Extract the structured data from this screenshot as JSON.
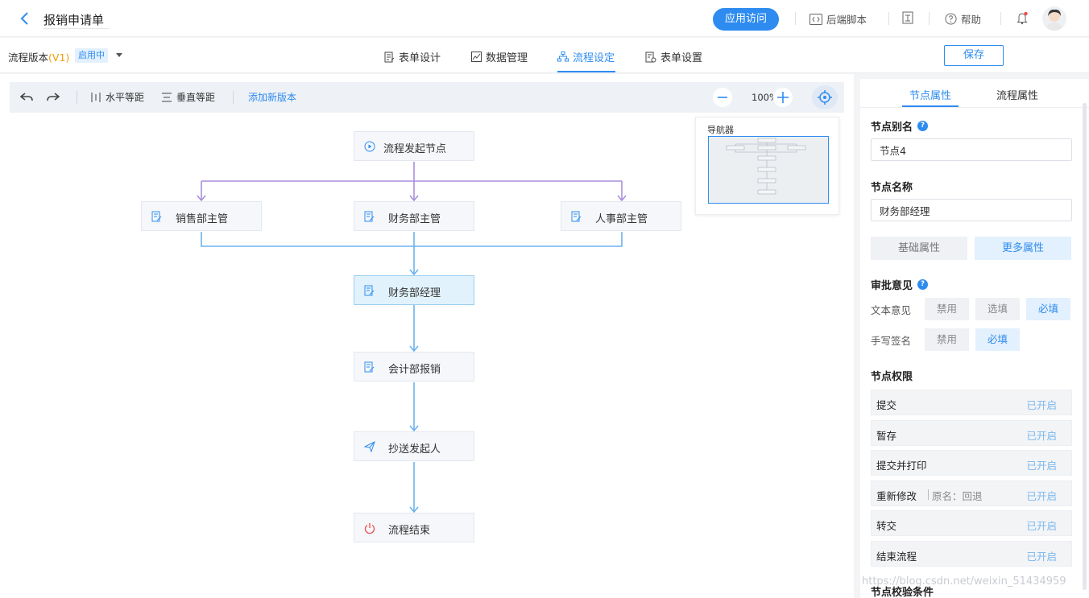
{
  "header": {
    "title": "报销申请单",
    "visit_button": "应用访问",
    "backend_script": "后端脚本",
    "help": "帮助"
  },
  "subheader": {
    "version_label": "流程版本",
    "version_number": "(V1)",
    "version_status": "启用中",
    "tabs": [
      {
        "label": "表单设计",
        "icon": "form-icon"
      },
      {
        "label": "数据管理",
        "icon": "data-icon"
      },
      {
        "label": "流程设定",
        "icon": "flow-icon",
        "active": true
      },
      {
        "label": "表单设置",
        "icon": "settings-icon"
      }
    ],
    "save_button": "保存"
  },
  "toolbar": {
    "horizontal_spacing": "水平等距",
    "vertical_spacing": "垂直等距",
    "add_version": "添加新版本",
    "zoom": "100%"
  },
  "flow": {
    "start_node": "流程发起节点",
    "branches": [
      "销售部主管",
      "财务部主管",
      "人事部主管"
    ],
    "selected_node": "财务部经理",
    "accounting_node": "会计部报销",
    "cc_node": "抄送发起人",
    "end_node": "流程结束"
  },
  "navigator": {
    "title": "导航器"
  },
  "panel": {
    "tabs": [
      "节点属性",
      "流程属性"
    ],
    "alias_title": "节点别名",
    "alias_value": "节点4",
    "name_title": "节点名称",
    "name_value": "财务部经理",
    "prop_tabs": [
      "基础属性",
      "更多属性"
    ],
    "approval_title": "审批意见",
    "text_opinion": {
      "label": "文本意见",
      "options": [
        "禁用",
        "选填",
        "必填"
      ],
      "selected": "必填"
    },
    "handwriting": {
      "label": "手写签名",
      "options": [
        "禁用",
        "必填"
      ],
      "selected": "必填"
    },
    "perm_title": "节点权限",
    "permissions": [
      {
        "name": "提交",
        "status": "已开启"
      },
      {
        "name": "暂存",
        "status": "已开启"
      },
      {
        "name": "提交并打印",
        "status": "已开启"
      },
      {
        "name": "重新修改",
        "alias": "原名：回退",
        "status": "已开启"
      },
      {
        "name": "转交",
        "status": "已开启"
      },
      {
        "name": "结束流程",
        "status": "已开启"
      }
    ],
    "validation_title": "节点校验条件"
  },
  "watermark": "https://blog.csdn.net/weixin_51434959",
  "colors": {
    "accent": "#2e8cf0",
    "branch_line": "#a98fde",
    "flow_line": "#6bb2f0"
  }
}
